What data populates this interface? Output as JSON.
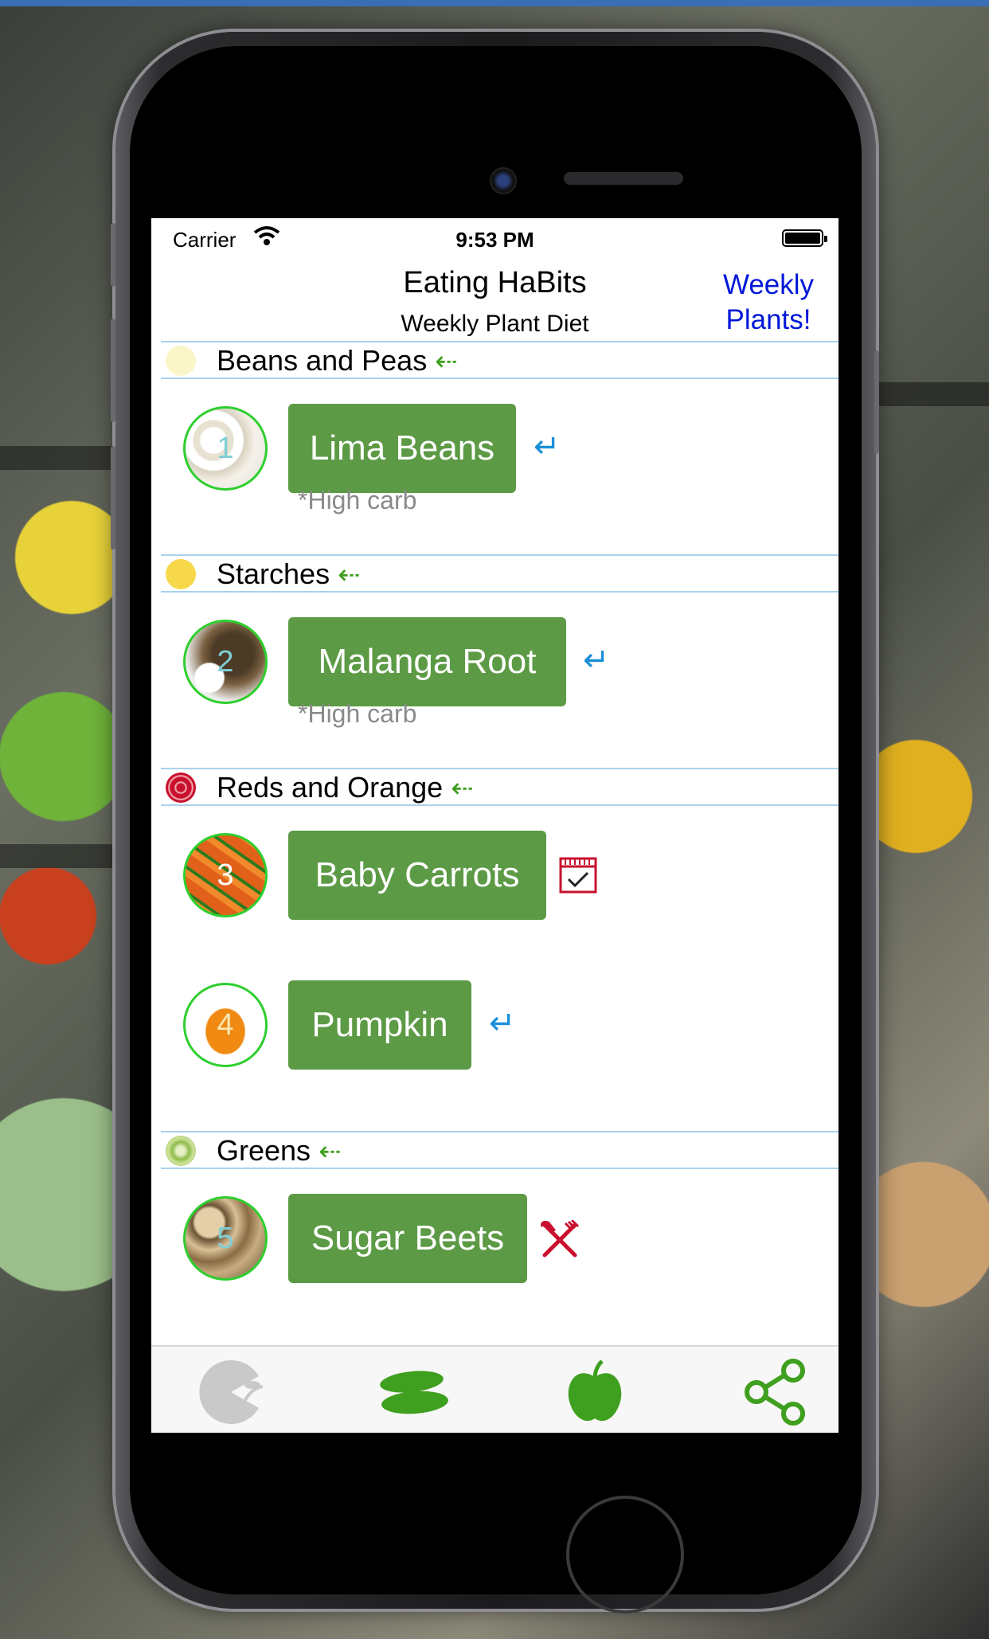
{
  "status_bar": {
    "carrier": "Carrier",
    "time": "9:53 PM"
  },
  "header": {
    "title": "Eating HaBits",
    "subtitle": "Weekly Plant Diet",
    "weekly_button": "Weekly\nPlants!"
  },
  "sections": [
    {
      "label": "Beans and Peas",
      "arrow": "⇠",
      "icon_color": "#fbf6c9"
    },
    {
      "label": "Starches",
      "arrow": "⇠",
      "icon_color": "#f6d84a"
    },
    {
      "label": "Reds and Orange",
      "arrow": "⇠",
      "icon_color": "#c8102e"
    },
    {
      "label": "Greens",
      "arrow": "⇠",
      "icon_color": "#8dbb4a"
    }
  ],
  "plants": [
    {
      "number": "1",
      "name": "Lima Beans",
      "note": "*High carb",
      "status_icon": "return-arrow-icon"
    },
    {
      "number": "2",
      "name": "Malanga Root",
      "note": "*High carb",
      "status_icon": "return-arrow-icon"
    },
    {
      "number": "3",
      "name": "Baby Carrots",
      "note": "",
      "status_icon": "calendar-check-icon"
    },
    {
      "number": "4",
      "name": "Pumpkin",
      "note": "",
      "status_icon": "return-arrow-icon"
    },
    {
      "number": "5",
      "name": "Sugar Beets",
      "note": "",
      "status_icon": "fork-knife-crossed-icon"
    }
  ],
  "tab_bar": {
    "tabs": [
      "pacman-sprout-icon",
      "cucumbers-icon",
      "apple-icon",
      "share-icon"
    ]
  },
  "colors": {
    "button_green": "#5c9a45",
    "accent_blue": "#0018d8",
    "arrow_green": "#3f9f1e",
    "divider_blue": "#a9d2ec"
  }
}
